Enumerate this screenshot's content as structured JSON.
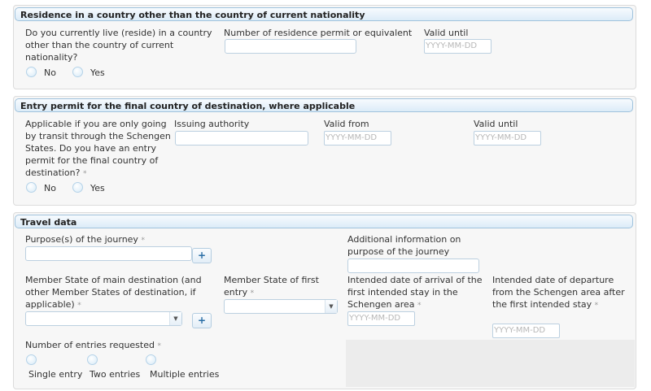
{
  "residence": {
    "title": "Residence in a country other than the country of current nationality",
    "question": "Do you currently live (reside) in a country other than the country of current nationality?",
    "option_no": "No",
    "option_yes": "Yes",
    "permit_label": "Number of residence permit or equivalent",
    "valid_until_label": "Valid until",
    "valid_until_placeholder": "YYYY-MM-DD"
  },
  "entry_permit": {
    "title": "Entry permit for the final country of destination, where applicable",
    "question": "Applicable if you are only going by transit through the Schengen States. Do you have an entry permit for the final country of destination?",
    "required_mark": "*",
    "option_no": "No",
    "option_yes": "Yes",
    "authority_label": "Issuing authority",
    "valid_from_label": "Valid from",
    "valid_from_placeholder": "YYYY-MM-DD",
    "valid_until_label": "Valid until",
    "valid_until_placeholder": "YYYY-MM-DD"
  },
  "travel": {
    "title": "Travel data",
    "purpose_label": "Purpose(s) of the journey",
    "required_mark": "*",
    "add_button": "+",
    "additional_info_label": "Additional information on purpose of the journey",
    "main_destination_label": "Member State of main destination (and other Member States of destination, if applicable)",
    "first_entry_label": "Member State of first entry",
    "arrival_label": "Intended date of arrival of the first intended stay in the Schengen area",
    "arrival_placeholder": "YYYY-MM-DD",
    "departure_label": "Intended date of departure from the Schengen area after the first intended stay",
    "departure_placeholder": "YYYY-MM-DD",
    "entries_label": "Number of entries requested",
    "entries_options": [
      "Single entry",
      "Two entries",
      "Multiple entries"
    ],
    "caret_icon": "chevron-down-icon"
  },
  "colors": {
    "header_border": "#9fc2dc",
    "header_bg": "#dcecf8",
    "panel_bg": "#f7f7f7",
    "radio_border": "#b4d2e8"
  }
}
